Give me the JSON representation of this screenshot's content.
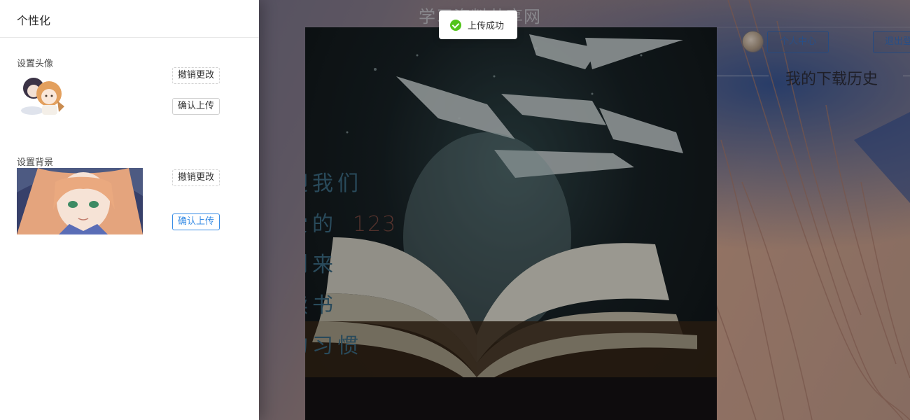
{
  "site": {
    "title": "学习资料共享网"
  },
  "header": {
    "personal_center_label": "个人中心",
    "logout_label": "退出登"
  },
  "main": {
    "history_title": "我的下载历史"
  },
  "poster": {
    "lines": [
      "迎我们",
      "爱的",
      "到来",
      "读书",
      "的习惯"
    ],
    "number": "123"
  },
  "drawer": {
    "title": "个性化",
    "avatar_section": {
      "label": "设置头像",
      "revert_label": "撤销更改",
      "upload_label": "确认上传"
    },
    "background_section": {
      "label": "设置背景",
      "revert_label": "撤销更改",
      "upload_label": "确认上传"
    }
  },
  "toast": {
    "message": "上传成功",
    "icon": "check-circle-icon",
    "color": "#52c41a"
  },
  "colors": {
    "accent": "#3a8ee6",
    "success": "#52c41a"
  }
}
